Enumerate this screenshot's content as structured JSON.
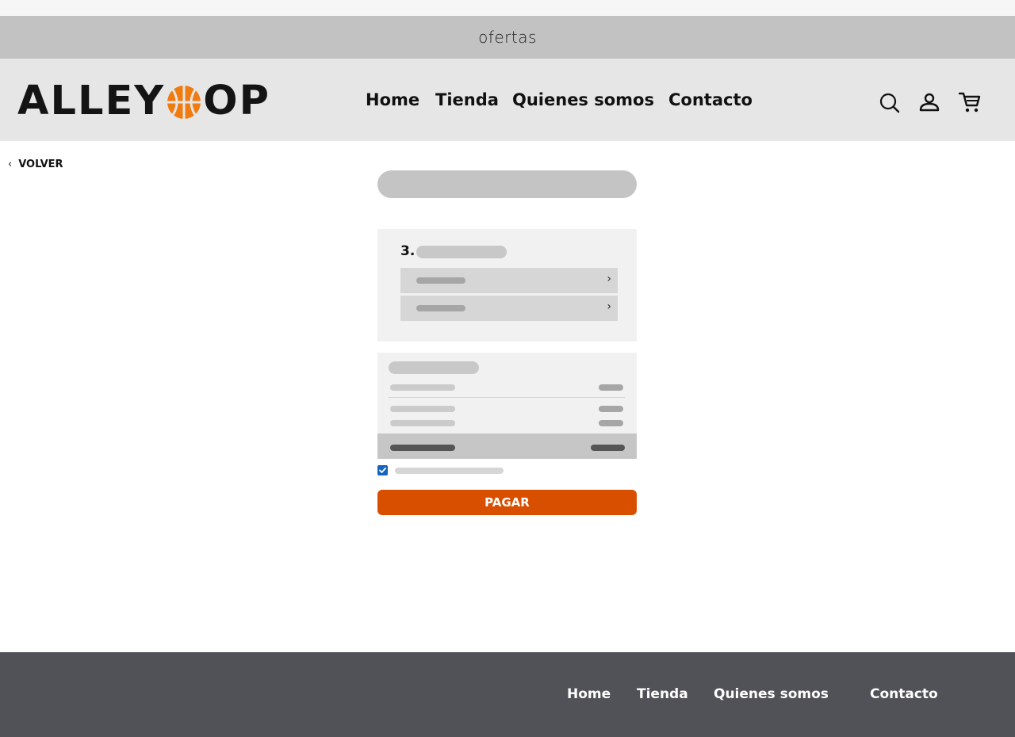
{
  "promo_bar": {
    "text": "ofertas"
  },
  "header": {
    "logo": {
      "text_left": "ALLEY",
      "text_right": "OP",
      "ball_color": "#f07c11"
    },
    "nav": [
      {
        "label": "Home"
      },
      {
        "label": "Tienda"
      },
      {
        "label": "Quienes somos"
      },
      {
        "label": "Contacto"
      }
    ],
    "icons": [
      "search-icon",
      "user-icon",
      "cart-icon"
    ]
  },
  "back_link": {
    "label": "VOLVER"
  },
  "checkout": {
    "step_number": "3.",
    "options": [
      {
        "arrow": "›"
      },
      {
        "arrow": "›"
      }
    ],
    "terms_checked": true,
    "pay_button": {
      "label": "PAGAR",
      "color": "#d94f00"
    }
  },
  "footer": {
    "nav": [
      {
        "label": "Home"
      },
      {
        "label": "Tienda"
      },
      {
        "label": "Quienes somos"
      },
      {
        "label": "Contacto"
      }
    ],
    "background": "#515257"
  }
}
